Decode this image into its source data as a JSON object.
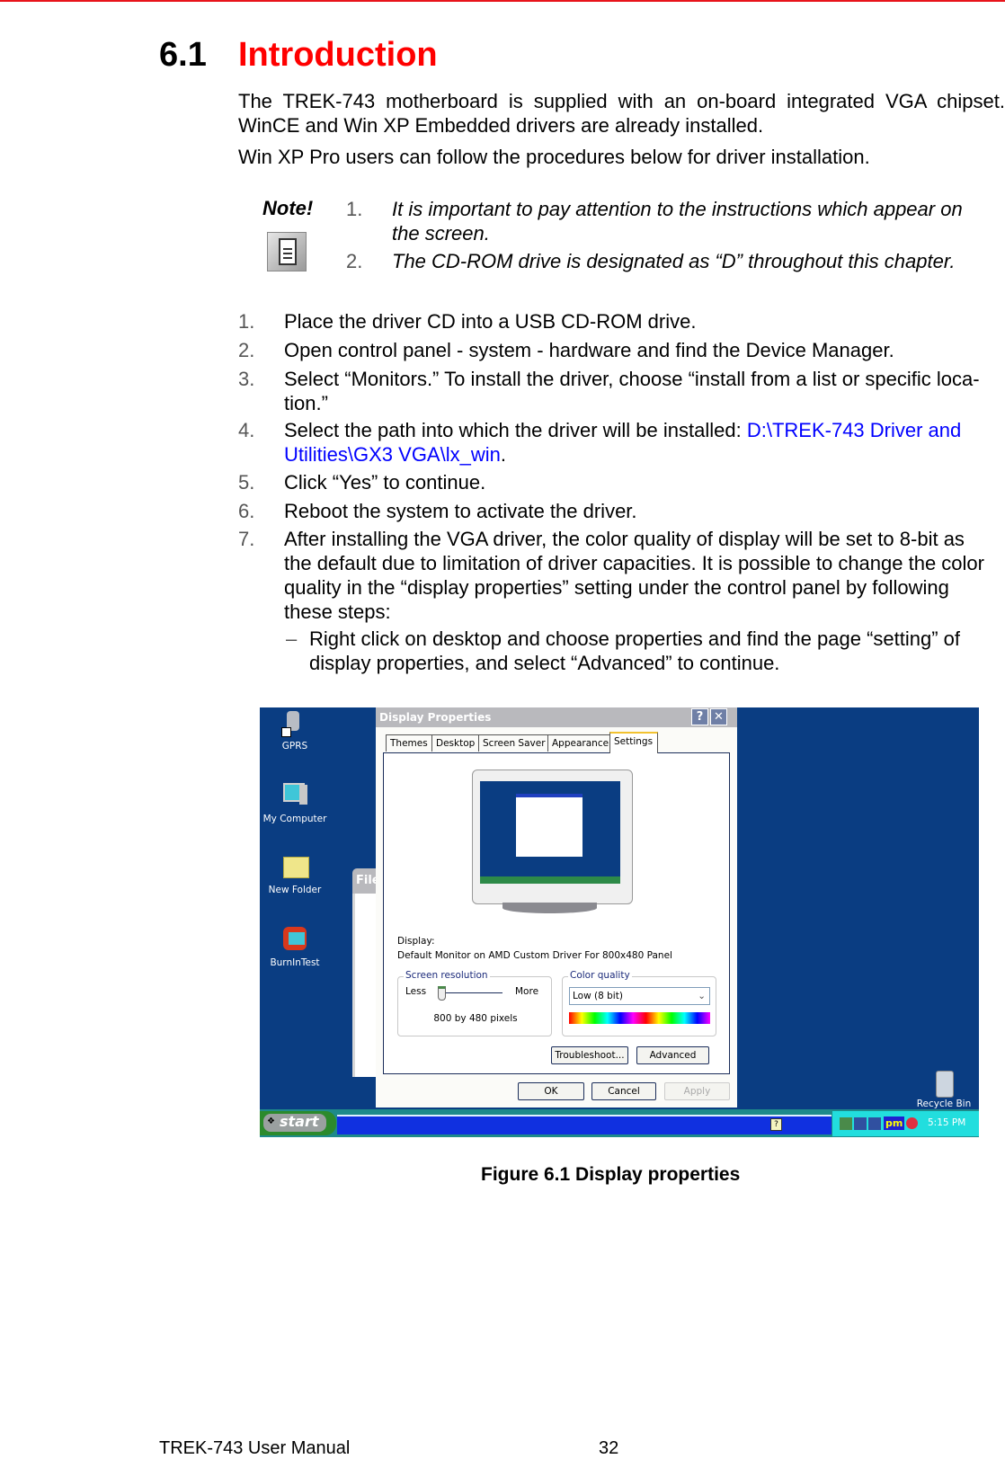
{
  "heading": {
    "number": "6.1",
    "title": "Introduction"
  },
  "intro": {
    "line1": "The TREK-743 motherboard is supplied with an on-board integrated VGA chipset.",
    "line2": "WinCE and Win XP Embedded drivers are already installed.",
    "line3": "Win XP Pro users can follow the procedures below for driver installation."
  },
  "note": {
    "label": "Note!",
    "icon": "document-note-icon",
    "items": [
      {
        "num": "1.",
        "lines": [
          "It is important to pay attention to the instructions which appear on",
          "the screen."
        ]
      },
      {
        "num": "2.",
        "lines": [
          "The CD-ROM drive is designated as “D” throughout this chapter."
        ]
      }
    ]
  },
  "steps": [
    {
      "num": "1.",
      "lines": [
        "Place the driver CD into a USB CD-ROM drive."
      ]
    },
    {
      "num": "2.",
      "lines": [
        "Open control panel - system - hardware and find the Device Manager."
      ]
    },
    {
      "num": "3.",
      "lines": [
        "Select “Monitors.” To install the driver, choose “install from a list or specific loca-",
        "tion.”"
      ]
    },
    {
      "num": "4.",
      "prefix": "Select the path into which the driver will be installed: ",
      "link_line1": "D:\\TREK-743 Driver and",
      "link_line2": "Utilities\\GX3 VGA\\lx_win",
      "suffix": "."
    },
    {
      "num": "5.",
      "lines": [
        "Click “Yes” to continue."
      ]
    },
    {
      "num": "6.",
      "lines": [
        "Reboot the system to activate the driver."
      ]
    },
    {
      "num": "7.",
      "lines": [
        "After installing the VGA driver, the color quality of display will be set to 8-bit as",
        "the default due to limitation of driver capacities. It is possible to change the color",
        "quality in the “display properties” setting under the control panel by following",
        "these steps:"
      ]
    }
  ],
  "substep": {
    "dash": "–",
    "lines": [
      "Right click on desktop and choose properties and find the page “setting” of",
      "display properties, and select “Advanced” to continue."
    ]
  },
  "screenshot": {
    "desktop_icons": [
      {
        "label": "GPRS",
        "icon": "gprs-shortcut-icon"
      },
      {
        "label": "My Computer",
        "icon": "my-computer-icon"
      },
      {
        "label": "New Folder",
        "icon": "folder-icon"
      },
      {
        "label": "BurnInTest",
        "icon": "burnintest-shortcut-icon"
      }
    ],
    "background_window_title": "File",
    "dialog": {
      "title": "Display Properties",
      "help_button": "?",
      "close_button": "✕",
      "tabs": [
        "Themes",
        "Desktop",
        "Screen Saver",
        "Appearance",
        "Settings"
      ],
      "active_tab": "Settings",
      "display_label": "Display:",
      "display_value": "Default Monitor on AMD Custom Driver For 800x480 Panel",
      "resolution": {
        "label": "Screen resolution",
        "less": "Less",
        "more": "More",
        "value": "800 by 480 pixels",
        "slider_fraction": 0
      },
      "color_quality": {
        "label": "Color quality",
        "selected": "Low (8 bit)"
      },
      "buttons": {
        "troubleshoot": "Troubleshoot...",
        "advanced": "Advanced",
        "ok": "OK",
        "cancel": "Cancel",
        "apply": "Apply"
      }
    },
    "recycle_bin": "Recycle Bin",
    "taskbar": {
      "start": "start",
      "tray_pm": "pm",
      "time": "5:15 PM"
    }
  },
  "caption": "Figure 6.1 Display properties",
  "footer": {
    "manual": "TREK-743 User Manual",
    "page": "32"
  },
  "colors": {
    "heading_red": "#ff0000",
    "link_blue": "#0000ff",
    "desktop_blue": "#0a3d82"
  }
}
